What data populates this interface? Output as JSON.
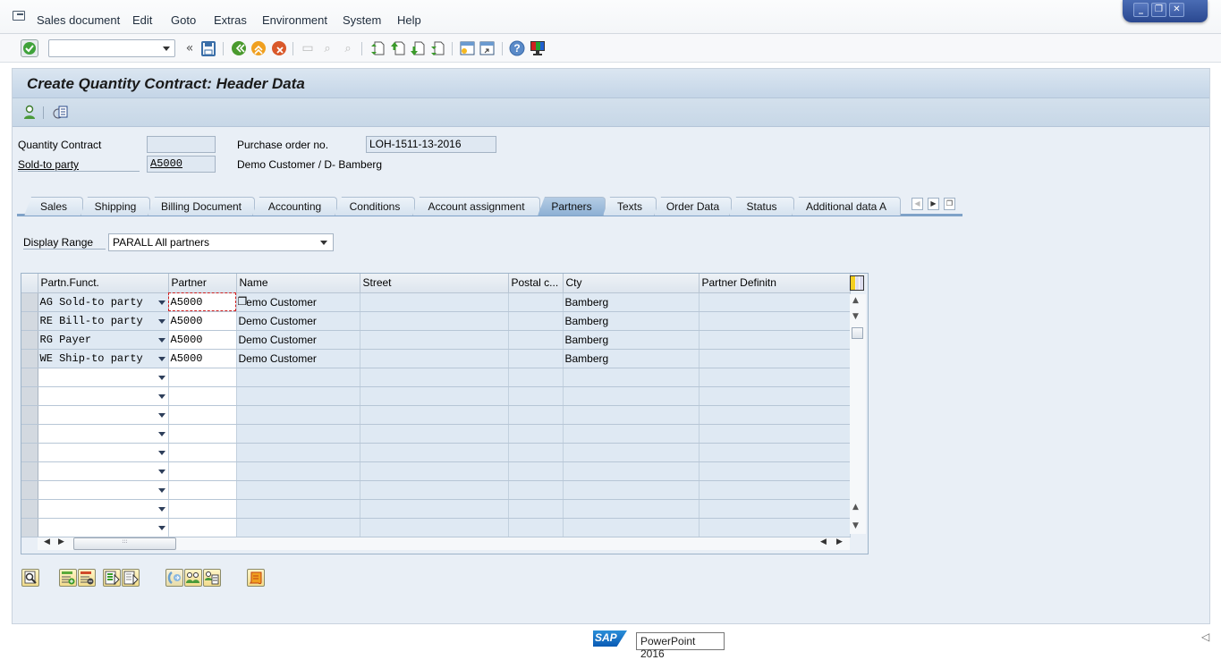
{
  "menubar": {
    "items": [
      "Sales document",
      "Edit",
      "Goto",
      "Extras",
      "Environment",
      "System",
      "Help"
    ]
  },
  "window_controls": {
    "minimize": "minimize",
    "restore": "restore",
    "close": "close"
  },
  "toolbar": {
    "command_field_value": "",
    "icons": [
      "enter-icon",
      "back-double-icon",
      "save-icon",
      "back-icon",
      "exit-icon",
      "cancel-icon",
      "print-icon",
      "find-icon",
      "find-next-icon",
      "first-page-icon",
      "previous-page-icon",
      "next-page-icon",
      "last-page-icon",
      "create-session-icon",
      "shortcut-icon",
      "help-icon",
      "customize-layout-icon"
    ]
  },
  "page": {
    "title": "Create Quantity Contract: Header Data"
  },
  "header": {
    "quantity_contract_label": "Quantity Contract",
    "quantity_contract_value": "",
    "sold_to_label": "Sold-to party",
    "sold_to_value": "A5000",
    "sold_to_description": "Demo Customer / D- Bamberg",
    "po_label": "Purchase order no.",
    "po_value": "LOH-1511-13-2016"
  },
  "tabs": [
    {
      "label": "Sales",
      "active": false
    },
    {
      "label": "Shipping",
      "active": false
    },
    {
      "label": "Billing Document",
      "active": false
    },
    {
      "label": "Accounting",
      "active": false
    },
    {
      "label": "Conditions",
      "active": false
    },
    {
      "label": "Account assignment",
      "active": false
    },
    {
      "label": "Partners",
      "active": true
    },
    {
      "label": "Texts",
      "active": false
    },
    {
      "label": "Order Data",
      "active": false
    },
    {
      "label": "Status",
      "active": false
    },
    {
      "label": "Additional data A",
      "active": false
    }
  ],
  "display_range": {
    "label": "Display Range",
    "value": "PARALL All partners"
  },
  "partners_table": {
    "columns": [
      "Partn.Funct.",
      "Partner",
      "Name",
      "Street",
      "Postal c...",
      "Cty",
      "Partner Definitn"
    ],
    "rows": [
      [
        "AG Sold-to party",
        "A5000",
        "Demo Customer",
        "",
        "",
        "Bamberg",
        ""
      ],
      [
        "RE Bill-to party",
        "A5000",
        "Demo Customer",
        "",
        "",
        "Bamberg",
        ""
      ],
      [
        "RG Payer",
        "A5000",
        "Demo Customer",
        "",
        "",
        "Bamberg",
        ""
      ],
      [
        "WE Ship-to party",
        "A5000",
        "Demo Customer",
        "",
        "",
        "Bamberg",
        ""
      ],
      [
        "",
        "",
        "",
        "",
        "",
        "",
        ""
      ],
      [
        "",
        "",
        "",
        "",
        "",
        "",
        ""
      ],
      [
        "",
        "",
        "",
        "",
        "",
        "",
        ""
      ],
      [
        "",
        "",
        "",
        "",
        "",
        "",
        ""
      ],
      [
        "",
        "",
        "",
        "",
        "",
        "",
        ""
      ],
      [
        "",
        "",
        "",
        "",
        "",
        "",
        ""
      ],
      [
        "",
        "",
        "",
        "",
        "",
        "",
        ""
      ],
      [
        "",
        "",
        "",
        "",
        "",
        "",
        ""
      ],
      [
        "",
        "",
        "",
        "",
        "",
        "",
        ""
      ]
    ]
  },
  "bottom_buttons": [
    "details-icon",
    "insert-row-icon",
    "delete-row-icon",
    "select-all-icon",
    "deselect-all-icon",
    "partner-call-icon",
    "partner-address-icon",
    "partner-detail-icon",
    "scroll-icon"
  ],
  "status": {
    "sap_logo": "SAP",
    "tooltip": "PowerPoint 2016"
  }
}
